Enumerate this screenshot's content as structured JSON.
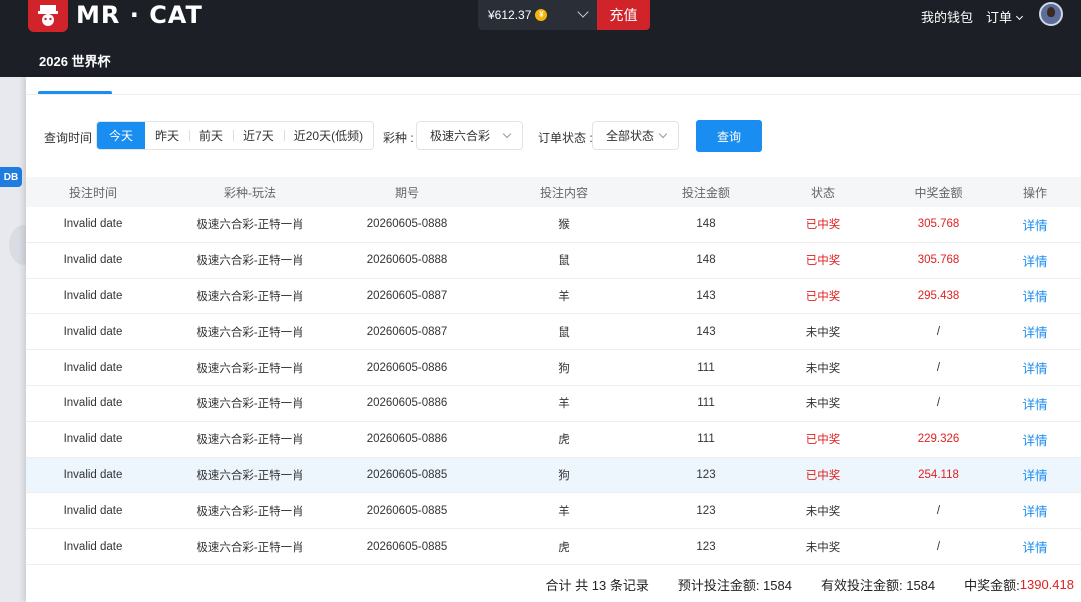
{
  "header": {
    "brand": "MR · CAT",
    "balance": "¥612.37",
    "coin_symbol": "¥",
    "recharge": "充值",
    "wallet": "我的钱包",
    "orders": "订单",
    "event": "2026 世界杯"
  },
  "sidebar": {
    "badge": "DB"
  },
  "filters": {
    "time_label": "查询时间 :",
    "time_options": [
      "今天",
      "昨天",
      "前天",
      "近7天",
      "近20天(低频)"
    ],
    "time_selected": "今天",
    "lottery_label": "彩种 :",
    "lottery_value": "极速六合彩",
    "status_label": "订单状态 :",
    "status_value": "全部状态",
    "query_button": "查询"
  },
  "table": {
    "columns": [
      "投注时间",
      "彩种-玩法",
      "期号",
      "投注内容",
      "投注金额",
      "状态",
      "中奖金额",
      "操作"
    ],
    "rows": [
      [
        "Invalid date",
        "极速六合彩-正特一肖",
        "20260605-0888",
        "猴",
        "148",
        "已中奖",
        "305.768",
        "详情"
      ],
      [
        "Invalid date",
        "极速六合彩-正特一肖",
        "20260605-0888",
        "鼠",
        "148",
        "已中奖",
        "305.768",
        "详情"
      ],
      [
        "Invalid date",
        "极速六合彩-正特一肖",
        "20260605-0887",
        "羊",
        "143",
        "已中奖",
        "295.438",
        "详情"
      ],
      [
        "Invalid date",
        "极速六合彩-正特一肖",
        "20260605-0887",
        "鼠",
        "143",
        "未中奖",
        "/",
        "详情"
      ],
      [
        "Invalid date",
        "极速六合彩-正特一肖",
        "20260605-0886",
        "狗",
        "111",
        "未中奖",
        "/",
        "详情"
      ],
      [
        "Invalid date",
        "极速六合彩-正特一肖",
        "20260605-0886",
        "羊",
        "111",
        "未中奖",
        "/",
        "详情"
      ],
      [
        "Invalid date",
        "极速六合彩-正特一肖",
        "20260605-0886",
        "虎",
        "111",
        "已中奖",
        "229.326",
        "详情"
      ],
      [
        "Invalid date",
        "极速六合彩-正特一肖",
        "20260605-0885",
        "狗",
        "123",
        "已中奖",
        "254.118",
        "详情"
      ],
      [
        "Invalid date",
        "极速六合彩-正特一肖",
        "20260605-0885",
        "羊",
        "123",
        "未中奖",
        "/",
        "详情"
      ],
      [
        "Invalid date",
        "极速六合彩-正特一肖",
        "20260605-0885",
        "虎",
        "123",
        "未中奖",
        "/",
        "详情"
      ]
    ],
    "highlighted_row": 7
  },
  "summary": {
    "records": "合计 共 13 条记录",
    "expected_bet": "预计投注金额: 1584",
    "valid_bet": "有效投注金额: 1584",
    "win_label": "中奖金额:",
    "win_value": "1390.418"
  },
  "colors": {
    "accent": "#1a8df0",
    "brand_red": "#d0232a",
    "win_red": "#e02020",
    "header_bg": "#1c1f26"
  }
}
